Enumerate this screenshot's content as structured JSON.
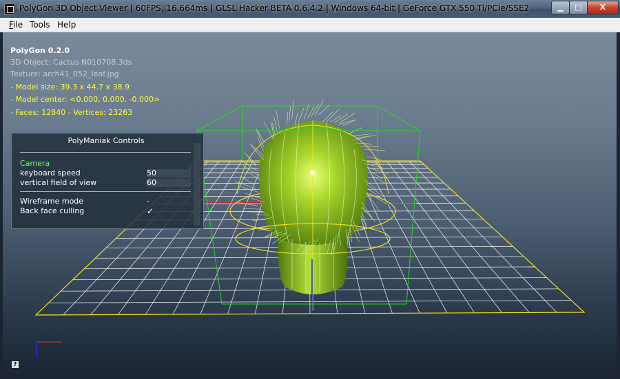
{
  "window": {
    "title": "PolyGon 3D Object Viewer | 60FPS, 16.664ms | GLSL Hacker BETA 0.6.4.2 | Windows 64-bit | GeForce GTX 550 Ti/PCIe/SSE2",
    "buttons": {
      "minimize": "▁",
      "maximize": "□",
      "close": "X"
    }
  },
  "menu": {
    "file_mnemonic": "F",
    "file_rest": "ile",
    "tools": "Tools",
    "help": "Help"
  },
  "info": {
    "title": "PolyGon 0.2.0",
    "object": "3D Object: Cactus N010708.3ds",
    "texture": "Texture: arch41_052_leaf.jpg",
    "model_size": "- Model size:  39.3 x 44.7 x 38.9",
    "model_center": "- Model center:  <0.000, 0.000, -0.000>",
    "faces_vertices": "- Faces: 12840 - Vertices: 23263"
  },
  "controls": {
    "title": "PolyManiak Controls",
    "section": "Camera",
    "keyboard_speed_label": "keyboard speed",
    "keyboard_speed_value": "50",
    "fov_label": "vertical field of view",
    "fov_value": "60",
    "wireframe_label": "Wireframe mode",
    "wireframe_value": "-",
    "cull_label": "Back face culling",
    "cull_value": "✓"
  },
  "help_icon": "?",
  "colors": {
    "grid": "#e6e6e6",
    "grid_border": "#f0e020",
    "bbox": "#22dd22",
    "cactus": "#8ec21e",
    "axis_x": "#e02020",
    "axis_z": "#2030d0"
  }
}
